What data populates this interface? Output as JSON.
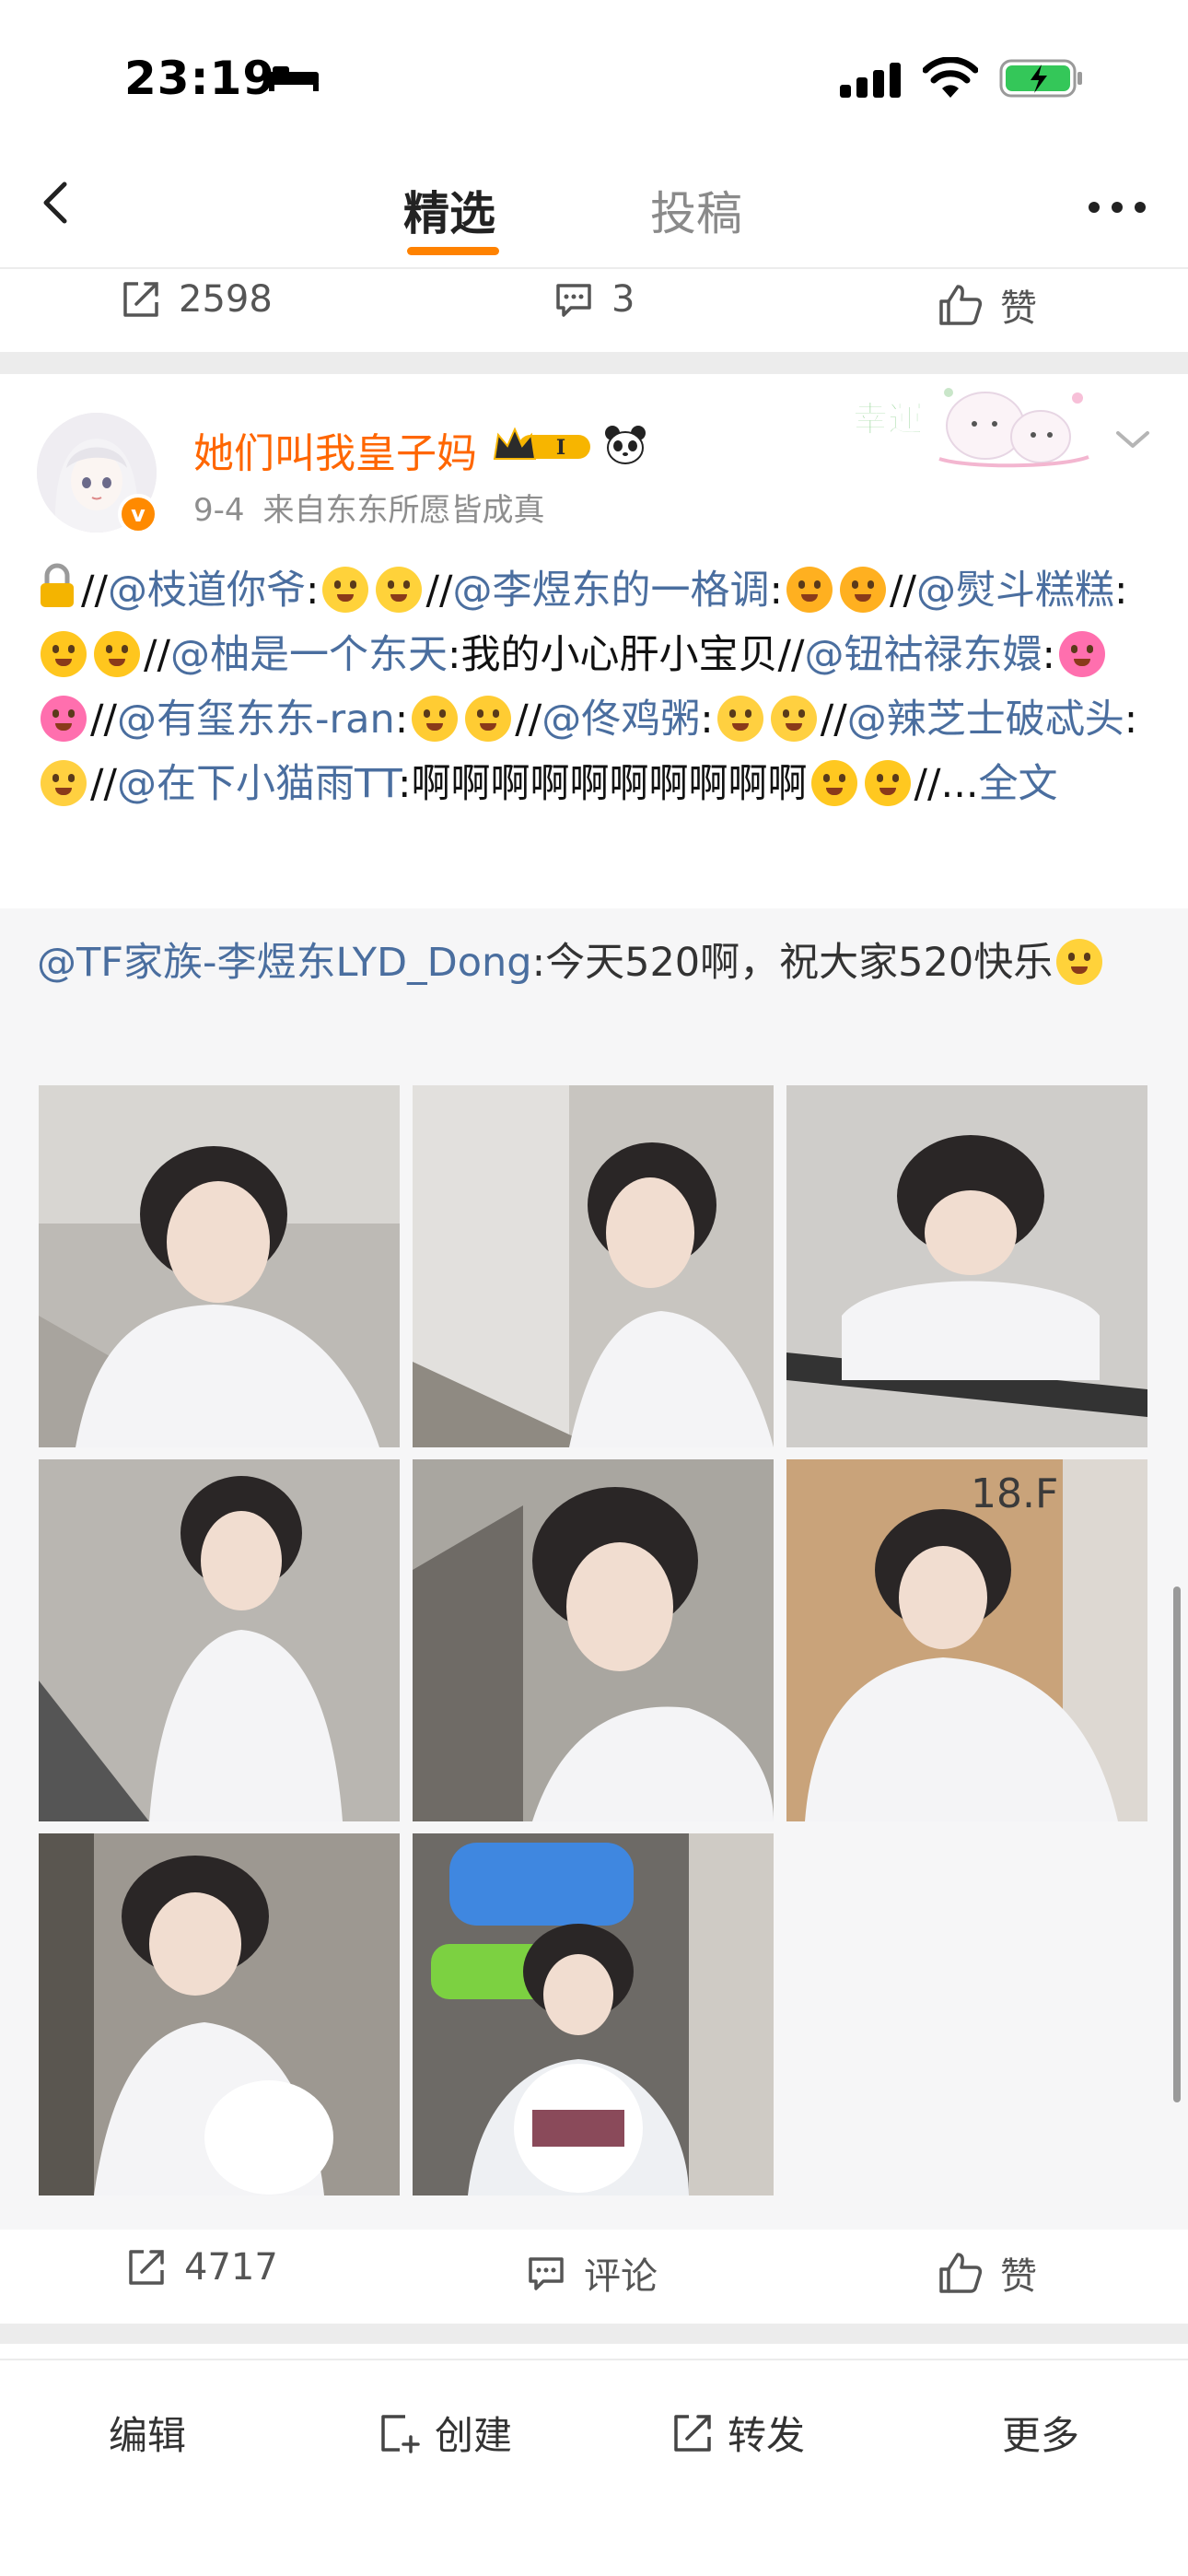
{
  "status_bar": {
    "time": "23:19"
  },
  "nav": {
    "tabs": [
      {
        "label": "精选"
      },
      {
        "label": "投稿"
      }
    ]
  },
  "prev_post": {
    "repost_count": "2598",
    "comment_count": "3",
    "like_label": "赞"
  },
  "post": {
    "author": "她们叫我皇子妈",
    "vip_level": "I",
    "date": "9-4",
    "source": "来自东东所愿皆成真",
    "sticker_text": "幸運",
    "text_segments": [
      {
        "t": "//",
        "c": "plain"
      },
      {
        "t": "@枝道你爷",
        "c": "mention"
      },
      {
        "t": ":",
        "c": "plain"
      },
      {
        "t": "",
        "c": "emo drool"
      },
      {
        "t": "",
        "c": "emo drool"
      },
      {
        "t": "//",
        "c": "plain"
      },
      {
        "t": "@李煜东的一格调",
        "c": "mention"
      },
      {
        "t": ":",
        "c": "plain"
      },
      {
        "t": "",
        "c": "emo kiss"
      },
      {
        "t": "",
        "c": "emo kiss"
      },
      {
        "t": "//",
        "c": "plain"
      },
      {
        "t": "@熨斗糕糕",
        "c": "mention"
      },
      {
        "t": ":",
        "c": "plain"
      },
      {
        "t": "",
        "c": "emo grin"
      },
      {
        "t": "",
        "c": "emo grin"
      },
      {
        "t": "//",
        "c": "plain"
      },
      {
        "t": "@柚是一个东天",
        "c": "mention"
      },
      {
        "t": ":我的小心肝小宝贝",
        "c": "plain"
      },
      {
        "t": "//",
        "c": "plain"
      },
      {
        "t": "@钮祜禄东嬛",
        "c": "mention"
      },
      {
        "t": ":",
        "c": "plain"
      },
      {
        "t": "",
        "c": "emo love"
      },
      {
        "t": "",
        "c": "emo love"
      },
      {
        "t": "//",
        "c": "plain"
      },
      {
        "t": "@有玺东东-ran",
        "c": "mention"
      },
      {
        "t": ":",
        "c": "plain"
      },
      {
        "t": "",
        "c": "emo cry"
      },
      {
        "t": "",
        "c": "emo cry"
      },
      {
        "t": "//",
        "c": "plain"
      },
      {
        "t": "@佟鸡粥",
        "c": "mention"
      },
      {
        "t": ":",
        "c": "plain"
      },
      {
        "t": "",
        "c": "emo wow"
      },
      {
        "t": "",
        "c": "emo wow"
      },
      {
        "t": "//",
        "c": "plain"
      },
      {
        "t": "@辣芝士破忒头",
        "c": "mention"
      },
      {
        "t": ":",
        "c": "plain"
      },
      {
        "t": "",
        "c": "emo wow"
      },
      {
        "t": "//",
        "c": "plain"
      },
      {
        "t": "@在下小猫雨TT",
        "c": "mention"
      },
      {
        "t": ":啊啊啊啊啊啊啊啊啊啊",
        "c": "plain"
      },
      {
        "t": "",
        "c": "emo plead"
      },
      {
        "t": "",
        "c": "emo plead"
      },
      {
        "t": "//...",
        "c": "plain"
      }
    ],
    "full_text_link": "全文",
    "repost": {
      "mention": "@TF家族-李煜东LYD_Dong",
      "text": ":今天520啊，祝大家520快乐"
    },
    "photos": [
      {
        "name": "photo-1",
        "caption": ""
      },
      {
        "name": "photo-2",
        "caption": ""
      },
      {
        "name": "photo-3",
        "caption": ""
      },
      {
        "name": "photo-4",
        "caption": ""
      },
      {
        "name": "photo-5",
        "caption": ""
      },
      {
        "name": "photo-6",
        "caption": "18.F"
      },
      {
        "name": "photo-7",
        "caption": ""
      },
      {
        "name": "photo-8",
        "caption": ""
      }
    ],
    "actions": {
      "repost_count": "4717",
      "comment_label": "评论",
      "like_label": "赞"
    }
  },
  "toolbar": {
    "edit": "编辑",
    "create": "创建",
    "forward": "转发",
    "more": "更多"
  },
  "colors": {
    "accent": "#ff8200",
    "link": "#4a6e9f",
    "username": "#ff6600"
  }
}
